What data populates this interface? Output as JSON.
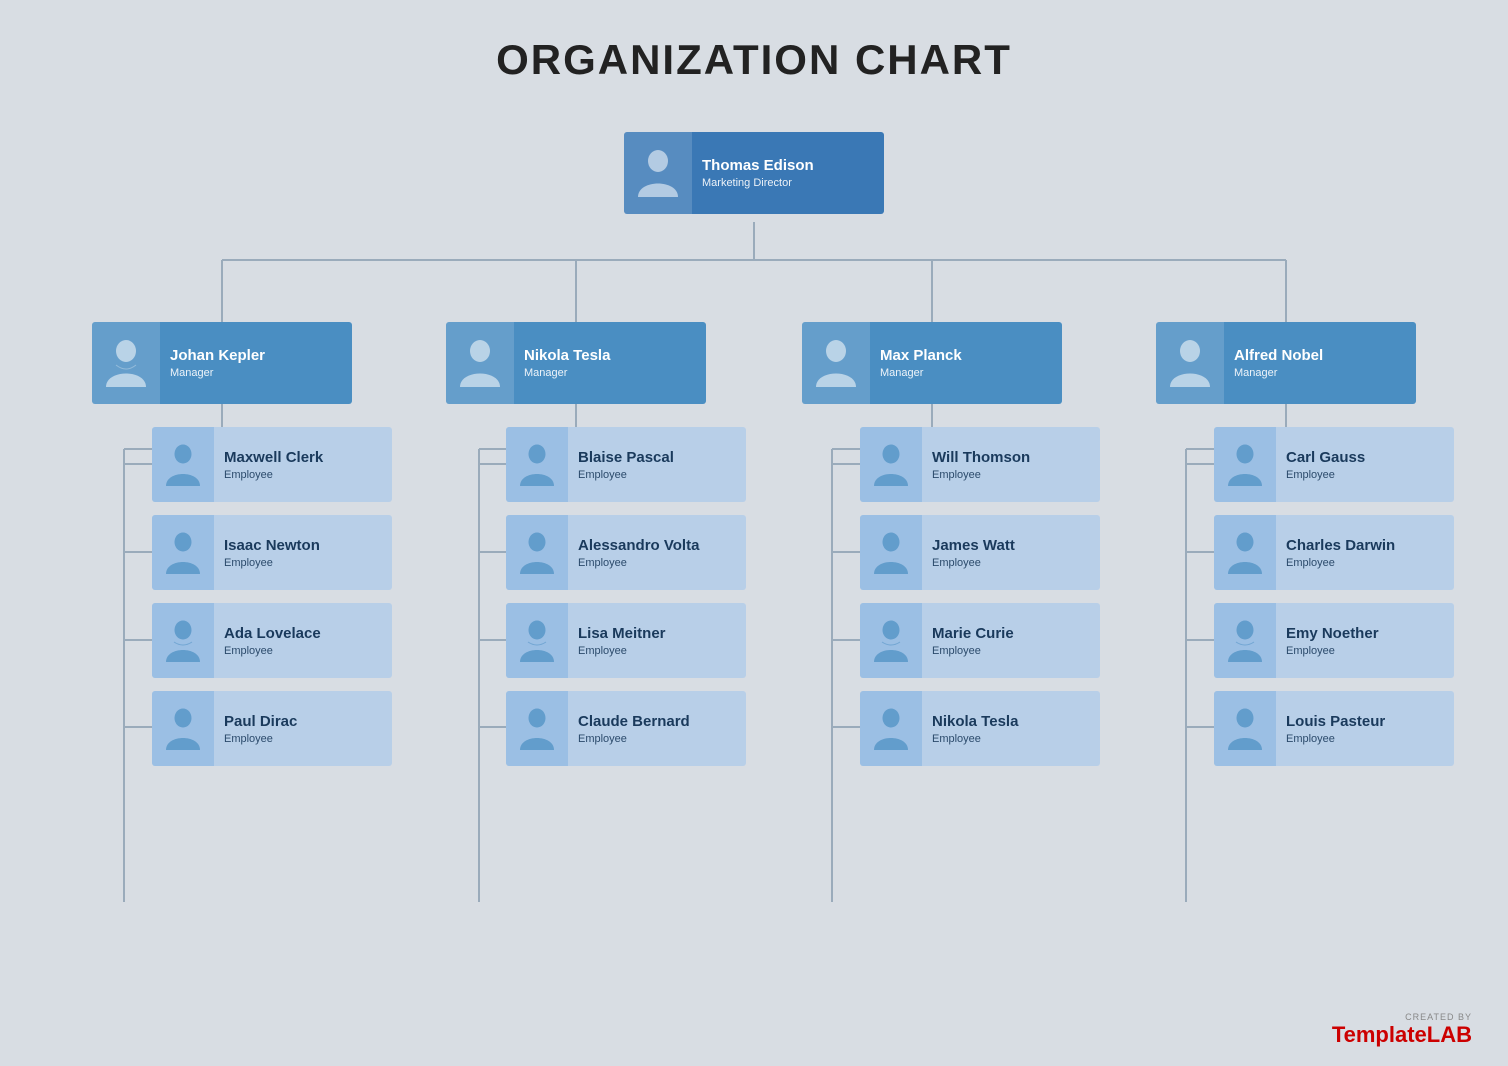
{
  "title": "ORGANIZATION CHART",
  "director": {
    "name": "Thomas Edison",
    "role": "Marketing Director",
    "avatar_type": "male"
  },
  "managers": [
    {
      "name": "Johan Kepler",
      "role": "Manager",
      "avatar_type": "female"
    },
    {
      "name": "Nikola Tesla",
      "role": "Manager",
      "avatar_type": "male"
    },
    {
      "name": "Max Planck",
      "role": "Manager",
      "avatar_type": "male"
    },
    {
      "name": "Alfred Nobel",
      "role": "Manager",
      "avatar_type": "male"
    }
  ],
  "employees": [
    [
      {
        "name": "Maxwell Clerk",
        "role": "Employee",
        "avatar_type": "male"
      },
      {
        "name": "Isaac Newton",
        "role": "Employee",
        "avatar_type": "male"
      },
      {
        "name": "Ada Lovelace",
        "role": "Employee",
        "avatar_type": "female"
      },
      {
        "name": "Paul Dirac",
        "role": "Employee",
        "avatar_type": "male"
      }
    ],
    [
      {
        "name": "Blaise Pascal",
        "role": "Employee",
        "avatar_type": "male"
      },
      {
        "name": "Alessandro Volta",
        "role": "Employee",
        "avatar_type": "male"
      },
      {
        "name": "Lisa Meitner",
        "role": "Employee",
        "avatar_type": "female"
      },
      {
        "name": "Claude Bernard",
        "role": "Employee",
        "avatar_type": "male"
      }
    ],
    [
      {
        "name": "Will Thomson",
        "role": "Employee",
        "avatar_type": "male"
      },
      {
        "name": "James Watt",
        "role": "Employee",
        "avatar_type": "male"
      },
      {
        "name": "Marie Curie",
        "role": "Employee",
        "avatar_type": "female"
      },
      {
        "name": "Nikola Tesla",
        "role": "Employee",
        "avatar_type": "male"
      }
    ],
    [
      {
        "name": "Carl Gauss",
        "role": "Employee",
        "avatar_type": "male"
      },
      {
        "name": "Charles Darwin",
        "role": "Employee",
        "avatar_type": "male"
      },
      {
        "name": "Emy Noether",
        "role": "Employee",
        "avatar_type": "female"
      },
      {
        "name": "Louis Pasteur",
        "role": "Employee",
        "avatar_type": "male"
      }
    ]
  ],
  "watermark": {
    "created_by": "CREATED BY",
    "brand_plain": "Template",
    "brand_colored": "LAB"
  },
  "colors": {
    "director_bg": "#3a78b5",
    "manager_bg": "#4a8ec2",
    "employee_bg": "#b8cfe8",
    "line_color": "#9aabbb",
    "bg": "#d8dde3"
  }
}
